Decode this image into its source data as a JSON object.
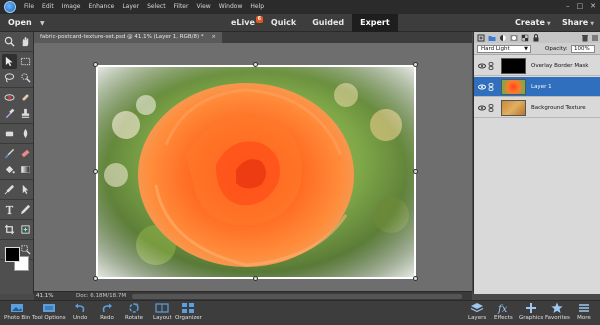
{
  "menubar": {
    "items": [
      "File",
      "Edit",
      "Image",
      "Enhance",
      "Layer",
      "Select",
      "Filter",
      "View",
      "Window",
      "Help"
    ],
    "controls": [
      "–",
      "□",
      "✕"
    ]
  },
  "modebar": {
    "open_label": "Open",
    "modes": [
      {
        "label": "eLive",
        "badge": "6"
      },
      {
        "label": "Quick"
      },
      {
        "label": "Guided"
      },
      {
        "label": "Expert",
        "active": true
      }
    ],
    "create_label": "Create",
    "share_label": "Share"
  },
  "document": {
    "tab_title": "fabric-postcard-texture-set.psd @ 41.1% (Layer 1, RGB/8) *",
    "close_glyph": "×",
    "zoom": "41.1%",
    "doc_size": "Doc: 6.18M/18.7M"
  },
  "layers_panel": {
    "blend_mode": "Hard Light",
    "opacity_label": "Opacity:",
    "opacity_value": "100%",
    "layers": [
      {
        "name": "Overlay Border Mask",
        "thumb": "black",
        "selected": false
      },
      {
        "name": "Layer 1",
        "thumb": "rose",
        "selected": true
      },
      {
        "name": "Background Texture",
        "thumb": "texture",
        "selected": false
      }
    ]
  },
  "bottombar": {
    "left": [
      {
        "label": "Photo Bin",
        "icon": "photo-bin-icon"
      },
      {
        "label": "Tool Options",
        "icon": "tool-options-icon"
      },
      {
        "label": "Undo",
        "icon": "undo-icon"
      },
      {
        "label": "Redo",
        "icon": "redo-icon"
      },
      {
        "label": "Rotate",
        "icon": "rotate-icon"
      },
      {
        "label": "Layout",
        "icon": "layout-icon"
      },
      {
        "label": "Organizer",
        "icon": "organizer-icon"
      }
    ],
    "right": [
      {
        "label": "Layers",
        "icon": "layers-icon"
      },
      {
        "label": "Effects",
        "icon": "effects-icon"
      },
      {
        "label": "Graphics",
        "icon": "graphics-icon"
      },
      {
        "label": "Favorites",
        "icon": "favorites-icon"
      },
      {
        "label": "More",
        "icon": "more-icon"
      }
    ]
  },
  "colors": {
    "accent_selection": "#2f6fbd",
    "foreground_color": "#000000",
    "background_color": "#ffffff"
  }
}
